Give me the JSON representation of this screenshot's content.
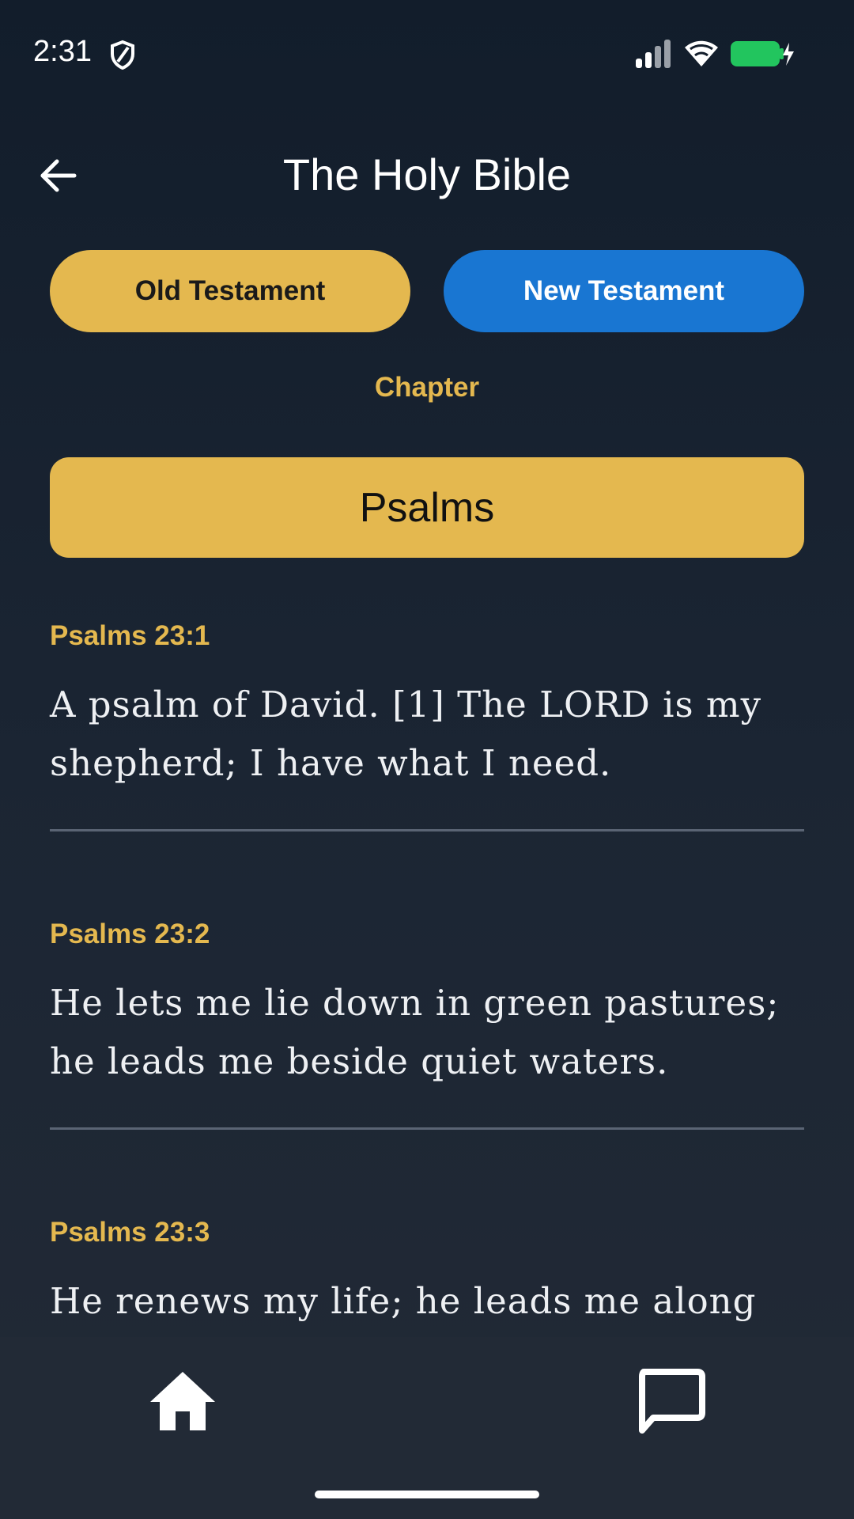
{
  "status_bar": {
    "time": "2:31",
    "icons": [
      "shield-icon",
      "signal-icon",
      "wifi-icon",
      "battery-charging-icon"
    ],
    "battery_color": "#22c55e"
  },
  "header": {
    "title": "The Holy Bible",
    "back_icon": "arrow-left-icon"
  },
  "testaments": {
    "old_label": "Old Testament",
    "new_label": "New Testament",
    "old_color": "#e4b84f",
    "new_color": "#1976d2"
  },
  "chapter_label": "Chapter",
  "book": {
    "selected": "Psalms"
  },
  "verses": [
    {
      "ref": "Psalms 23:1",
      "text": "A psalm of David. [1] The LORD is my shepherd; I have what I need."
    },
    {
      "ref": "Psalms 23:2",
      "text": "He lets me lie down in green pastures; he leads me beside quiet waters."
    },
    {
      "ref": "Psalms 23:3",
      "text": "He renews my life; he leads me along"
    }
  ],
  "bottom_nav": {
    "items": [
      "home-icon",
      "message-icon"
    ]
  },
  "colors": {
    "accent": "#e4b84f",
    "primary": "#1976d2",
    "background": "#121d2b"
  }
}
